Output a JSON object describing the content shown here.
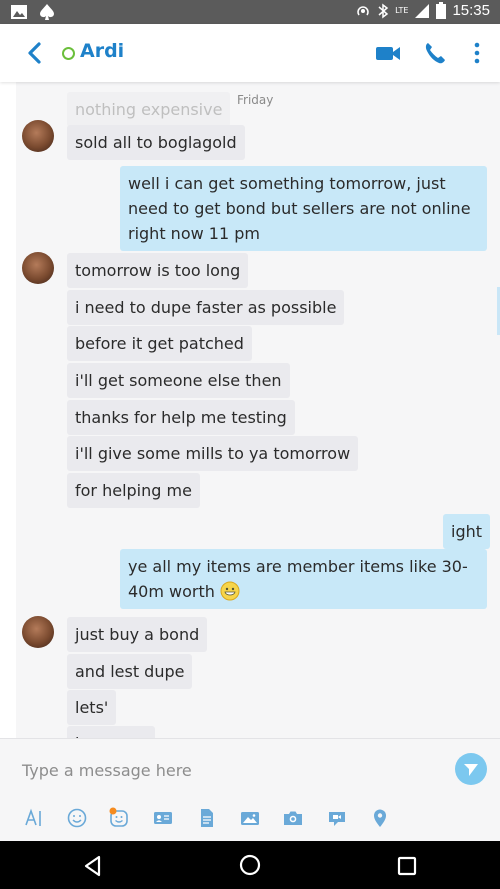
{
  "status_bar": {
    "time": "15:35",
    "network": "LTE"
  },
  "header": {
    "contact_name": "Ardi"
  },
  "day_separator": "Friday",
  "messages": {
    "m0": "nothing expensive",
    "m1": "sold all to boglagold",
    "m2": "well i can get something tomorrow, just need to get bond but sellers are not online right now 11 pm",
    "m3": "tomorrow is too long",
    "m4": "i need to dupe faster as possible",
    "m5": "before it get patched",
    "m6": "i'll get someone else then",
    "m7": "thanks for help me testing",
    "m8": "i'll give some mills to ya tomorrow",
    "m9": "for helping me",
    "m10": "ight",
    "m11": "ye all my items are member items like 30-40m worth",
    "m12": "just buy a bond",
    "m13": "and lest dupe",
    "m14": "lets'",
    "m15": "l"
  },
  "composer": {
    "placeholder": "Type a message here"
  },
  "colors": {
    "accent": "#1e81c9",
    "outgoing_bubble": "#c8e8f8",
    "incoming_bubble": "#eaeaee",
    "presence": "#6bbf3b"
  },
  "icons": {
    "status_left": [
      "image-icon",
      "spade-icon"
    ],
    "status_right": [
      "hotspot-icon",
      "bluetooth-icon",
      "signal-icon",
      "battery-icon"
    ],
    "header_actions": [
      "video-call-icon",
      "phone-icon",
      "more-icon"
    ],
    "toolbar": [
      "text-format-icon",
      "emoji-icon",
      "sticker-icon",
      "contact-card-icon",
      "file-icon",
      "photo-icon",
      "camera-icon",
      "video-message-icon",
      "location-icon"
    ],
    "nav": [
      "back-nav-icon",
      "home-nav-icon",
      "recents-nav-icon"
    ]
  }
}
